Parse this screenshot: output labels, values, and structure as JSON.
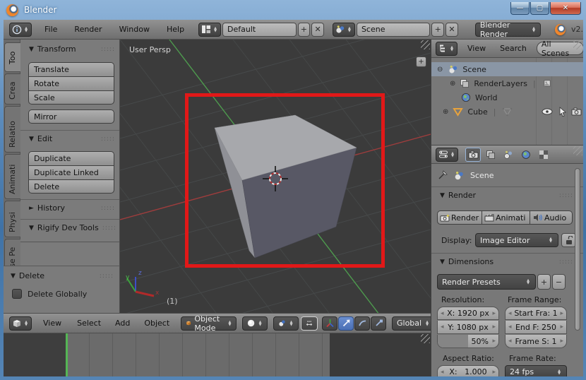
{
  "window": {
    "title": "Blender",
    "version": "v2."
  },
  "icons": {
    "plus": "+",
    "close_x": "✕",
    "open": "▼",
    "closed": "►",
    "minimize": "—",
    "maximize": "▢"
  },
  "topbar": {
    "menu_file": "File",
    "menu_render": "Render",
    "menu_window": "Window",
    "menu_help": "Help",
    "layout_value": "Default",
    "scene_value": "Scene",
    "engine_value": "Blender Render"
  },
  "toolshelf": {
    "tabs": [
      "Too",
      "Crea",
      "Relatio",
      "Animati",
      "Physi",
      "Grease Pe"
    ],
    "transform": {
      "title": "Transform",
      "translate": "Translate",
      "rotate": "Rotate",
      "scale": "Scale",
      "mirror": "Mirror"
    },
    "edit": {
      "title": "Edit",
      "duplicate": "Duplicate",
      "duplicate_linked": "Duplicate Linked",
      "delete": "Delete"
    },
    "history": {
      "title": "History"
    },
    "rigify": {
      "title": "Rigify Dev Tools"
    },
    "operator": {
      "title": "Delete",
      "checkbox_label": "Delete Globally",
      "checked": false
    }
  },
  "viewport": {
    "view_label": "User Persp",
    "frame_indicator": "(1)",
    "axis_x": "x",
    "axis_y": "y",
    "axis_z": "z",
    "annotation_color": "#e11818"
  },
  "view3d_header": {
    "menu_view": "View",
    "menu_select": "Select",
    "menu_add": "Add",
    "menu_object": "Object",
    "mode": "Object Mode",
    "orientation": "Global"
  },
  "outliner": {
    "menu_view": "View",
    "menu_search": "Search",
    "filter": "All Scenes",
    "scene": "Scene",
    "renderlayers": "RenderLayers",
    "world": "World",
    "cube": "Cube"
  },
  "properties": {
    "context": "Scene",
    "render_panel": {
      "title": "Render",
      "btn_render": "Render",
      "btn_animation": "Animati",
      "btn_audio": "Audio",
      "display_label": "Display:",
      "display_value": "Image Editor"
    },
    "dimensions_panel": {
      "title": "Dimensions",
      "presets": "Render Presets",
      "resolution_label": "Resolution:",
      "frame_range_label": "Frame Range:",
      "res_x": "X: 1920 px",
      "res_y": "Y: 1080 px",
      "res_scale": "50%",
      "start": "Start Fra: 1",
      "end": "End F: 250",
      "step": "Frame S: 1",
      "aspect_label": "Aspect Ratio:",
      "framerate_label": "Frame Rate:",
      "aspect_x": "X:   1.000",
      "fps": "24 fps"
    }
  }
}
